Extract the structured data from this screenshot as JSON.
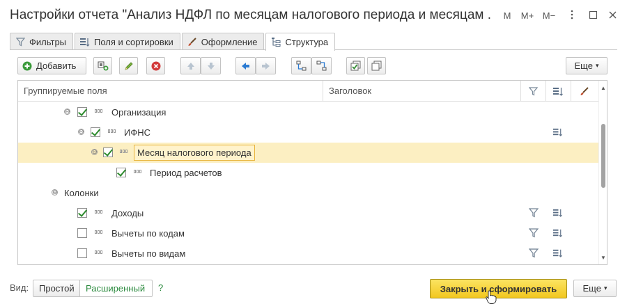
{
  "window": {
    "title": "Настройки отчета \"Анализ НДФЛ по месяцам налогового периода и месяцам ...",
    "controls": [
      "M",
      "M+",
      "M−",
      "□",
      "✕"
    ]
  },
  "tabs": [
    {
      "label": "Фильтры",
      "icon": "funnel-icon",
      "active": false
    },
    {
      "label": "Поля и сортировки",
      "icon": "sort-fields-icon",
      "active": false
    },
    {
      "label": "Оформление",
      "icon": "brush-icon",
      "active": false
    },
    {
      "label": "Структура",
      "icon": "structure-icon",
      "active": true
    }
  ],
  "toolbar": {
    "add_label": "Добавить",
    "more_label": "Еще",
    "more_arrow": "▾"
  },
  "table": {
    "headers": {
      "fields": "Группируемые поля",
      "caption": "Заголовок"
    },
    "rows": [
      {
        "label": "Организация",
        "checked": true,
        "expander": "⊖",
        "selected": false
      },
      {
        "label": "ИФНС",
        "checked": true,
        "expander": "⊖",
        "selected": false
      },
      {
        "label": "Месяц налогового периода",
        "checked": true,
        "expander": "⊖",
        "selected": true
      },
      {
        "label": "Период расчетов",
        "checked": true,
        "expander": "",
        "selected": false
      },
      {
        "label": "Колонки",
        "checked": false,
        "expander": "⊖",
        "selected": false
      },
      {
        "label": "Доходы",
        "checked": true,
        "expander": "",
        "selected": false
      },
      {
        "label": "Вычеты по кодам",
        "checked": false,
        "expander": "",
        "selected": false
      },
      {
        "label": "Вычеты по видам",
        "checked": false,
        "expander": "",
        "selected": false
      }
    ]
  },
  "footer": {
    "view_label": "Вид:",
    "simple_label": "Простой",
    "advanced_label": "Расширенный",
    "help_label": "?",
    "primary_label": "Закрыть и сформировать",
    "more_label": "Еще",
    "more_arrow": "▾"
  },
  "colors": {
    "accent_green": "#2b8a3e",
    "selection": "#fcefc2",
    "primary_button": "#f2c71f"
  }
}
